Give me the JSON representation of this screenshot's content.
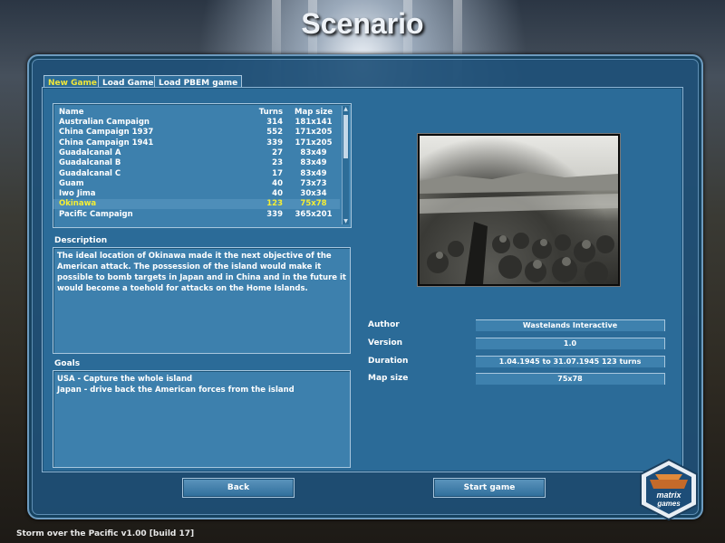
{
  "header": {
    "title": "Scenario"
  },
  "tabs": [
    {
      "label": "New Game",
      "active": true
    },
    {
      "label": "Load Game",
      "active": false
    },
    {
      "label": "Load PBEM game",
      "active": false
    }
  ],
  "scenario_list": {
    "columns": {
      "name": "Name",
      "turns": "Turns",
      "map_size": "Map size"
    },
    "rows": [
      {
        "name": "Australian Campaign",
        "turns": "314",
        "map_size": "181x141"
      },
      {
        "name": "China Campaign 1937",
        "turns": "552",
        "map_size": "171x205"
      },
      {
        "name": "China Campaign 1941",
        "turns": "339",
        "map_size": "171x205"
      },
      {
        "name": "Guadalcanal A",
        "turns": "27",
        "map_size": "83x49"
      },
      {
        "name": "Guadalcanal B",
        "turns": "23",
        "map_size": "83x49"
      },
      {
        "name": "Guadalcanal C",
        "turns": "17",
        "map_size": "83x49"
      },
      {
        "name": "Guam",
        "turns": "40",
        "map_size": "73x73"
      },
      {
        "name": "Iwo Jima",
        "turns": "40",
        "map_size": "30x34"
      },
      {
        "name": "Okinawa",
        "turns": "123",
        "map_size": "75x78"
      },
      {
        "name": "Pacific Campaign",
        "turns": "339",
        "map_size": "365x201"
      }
    ],
    "selected_index": 8,
    "scroll_up_icon": "triangle-up",
    "scroll_down_icon": "triangle-down"
  },
  "description": {
    "label": "Description",
    "text": "The ideal location of Okinawa made it the next objective of the American attack. The possession of the island would make it possible to bomb targets in Japan and in China and in the future it would become a toehold for attacks on the Home Islands."
  },
  "goals": {
    "label": "Goals",
    "lines": [
      "USA - Capture the whole island",
      "Japan - drive back the American forces from the island"
    ]
  },
  "info": {
    "author_label": "Author",
    "author": "Wastelands Interactive",
    "version_label": "Version",
    "version": "1.0",
    "duration_label": "Duration",
    "duration": "1.04.1945 to 31.07.1945   123 turns",
    "mapsize_label": "Map size",
    "mapsize": "75x78"
  },
  "buttons": {
    "back": "Back",
    "start": "Start game"
  },
  "status_bar": "Storm over the Pacific v1.00 [build  17]",
  "logo": {
    "line1": "matrix",
    "line2": "games"
  },
  "colors": {
    "accent": "#f5ee35",
    "panel": "#2b6b98",
    "border": "#a8c7de"
  }
}
